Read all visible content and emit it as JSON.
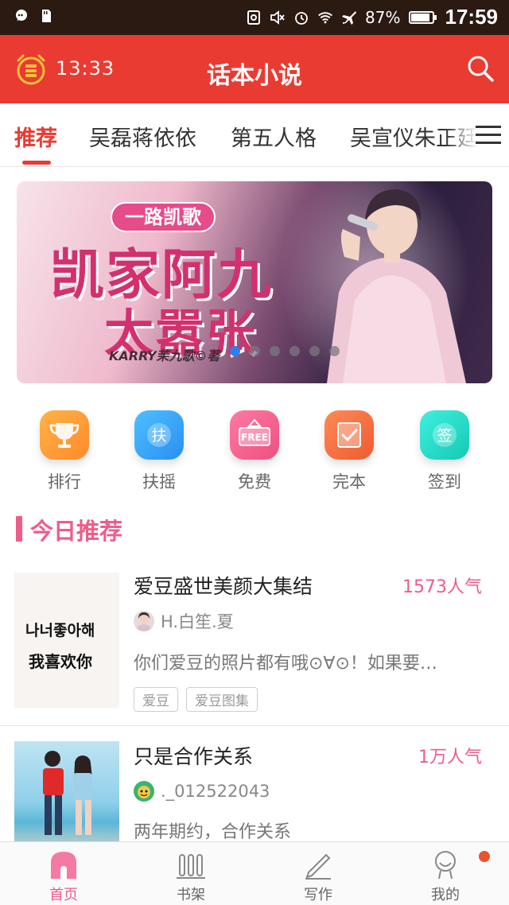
{
  "status_bar": {
    "battery": "87%",
    "time": "17:59"
  },
  "app_bar": {
    "alarm_time": "13:33",
    "title": "话本小说"
  },
  "tabs": [
    {
      "label": "推荐",
      "active": true
    },
    {
      "label": "吴磊蒋依依",
      "active": false
    },
    {
      "label": "第五人格",
      "active": false
    },
    {
      "label": "吴宣仪朱正廷",
      "active": false
    }
  ],
  "banner": {
    "tag": "一路凯歌",
    "title_line1": "凯家阿九",
    "title_line2": "太嚣张",
    "author": "KARRY茉九歌©著",
    "slide_count": 6,
    "active_slide": 0
  },
  "quick_entries": [
    {
      "label": "排行",
      "icon": "trophy-icon",
      "color": "#ff9a3c"
    },
    {
      "label": "扶摇",
      "icon": "fuyao-icon",
      "glyph": "扶",
      "color": "#35a6f2"
    },
    {
      "label": "免费",
      "icon": "free-icon",
      "glyph": "FREE",
      "color": "#f25c8a"
    },
    {
      "label": "完本",
      "icon": "check-icon",
      "color": "#f2673f"
    },
    {
      "label": "签到",
      "icon": "signin-icon",
      "glyph": "签",
      "color": "#27d9c8"
    }
  ],
  "section": {
    "title": "今日推荐"
  },
  "books": [
    {
      "title": "爱豆盛世美颜大集结",
      "popularity": "1573人气",
      "author": "H.白笙.夏",
      "description": "你们爱豆的照片都有哦⊙∀⊙！如果要…",
      "tags": [
        "爱豆",
        "爱豆图集"
      ],
      "cover_text_line1": "나너좋아해",
      "cover_text_line2": "我喜欢你"
    },
    {
      "title": "只是合作关系",
      "popularity": "1万人气",
      "author": "._012522043",
      "description": "两年期约，合作关系",
      "tags": []
    }
  ],
  "bottom_nav": [
    {
      "label": "首页",
      "icon": "home-icon",
      "active": true
    },
    {
      "label": "书架",
      "icon": "bookshelf-icon",
      "active": false
    },
    {
      "label": "写作",
      "icon": "pen-icon",
      "active": false
    },
    {
      "label": "我的",
      "icon": "profile-icon",
      "active": false,
      "badge": true
    }
  ],
  "colors": {
    "brand_red": "#e93b32",
    "accent_pink": "#ee5d8a",
    "status_bar": "#2b1a12"
  }
}
